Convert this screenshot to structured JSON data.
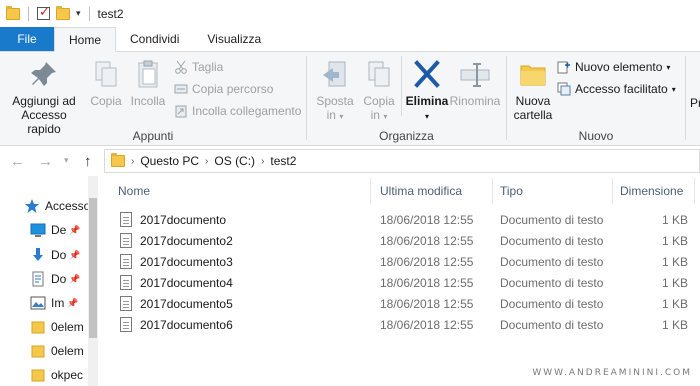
{
  "window": {
    "title": "test2"
  },
  "tabs": [
    {
      "label": "File"
    },
    {
      "label": "Home"
    },
    {
      "label": "Condividi"
    },
    {
      "label": "Visualizza"
    }
  ],
  "ribbon": {
    "appunti": {
      "label": "Appunti",
      "pin_label": "Aggiungi ad Accesso rapido",
      "pin_line1": "Aggiungi ad",
      "pin_line2": "Accesso rapido",
      "copy_label": "Copia",
      "paste_label": "Incolla",
      "cut_label": "Taglia",
      "copy_path_label": "Copia percorso",
      "paste_shortcut_label": "Incolla collegamento"
    },
    "organizza": {
      "label": "Organizza",
      "move_line1": "Sposta",
      "move_line2": "in",
      "copyto_line1": "Copia",
      "copyto_line2": "in",
      "delete_label": "Elimina",
      "rename_label": "Rinomina"
    },
    "nuovo": {
      "label": "Nuovo",
      "new_folder_line1": "Nuova",
      "new_folder_line2": "cartella",
      "new_item_label": "Nuovo elemento",
      "easy_access_label": "Accesso facilitato"
    },
    "next_group_partial": "Pr"
  },
  "address": {
    "segments": [
      "Questo PC",
      "OS (C:)",
      "test2"
    ]
  },
  "nav_pane": {
    "items": [
      {
        "label": "Accesso",
        "icon": "star-icon"
      },
      {
        "label": "De",
        "icon": "desktop-icon"
      },
      {
        "label": "Do",
        "icon": "download-icon"
      },
      {
        "label": "Do",
        "icon": "document-icon"
      },
      {
        "label": "Im",
        "icon": "image-icon"
      },
      {
        "label": "0elem",
        "icon": "folder-icon"
      },
      {
        "label": "0elem",
        "icon": "folder-icon"
      },
      {
        "label": "okpec",
        "icon": "folder-icon"
      }
    ]
  },
  "file_list": {
    "columns": [
      "Nome",
      "Ultima modifica",
      "Tipo",
      "Dimensione"
    ],
    "rows": [
      {
        "name": "2017documento",
        "modified": "18/06/2018 12:55",
        "type": "Documento di testo",
        "size": "1 KB"
      },
      {
        "name": "2017documento2",
        "modified": "18/06/2018 12:55",
        "type": "Documento di testo",
        "size": "1 KB"
      },
      {
        "name": "2017documento3",
        "modified": "18/06/2018 12:55",
        "type": "Documento di testo",
        "size": "1 KB"
      },
      {
        "name": "2017documento4",
        "modified": "18/06/2018 12:55",
        "type": "Documento di testo",
        "size": "1 KB"
      },
      {
        "name": "2017documento5",
        "modified": "18/06/2018 12:55",
        "type": "Documento di testo",
        "size": "1 KB"
      },
      {
        "name": "2017documento6",
        "modified": "18/06/2018 12:55",
        "type": "Documento di testo",
        "size": "1 KB"
      }
    ]
  },
  "watermark": "WWW.ANDREAMININI.COM",
  "colors": {
    "accent": "#1979ca",
    "folder": "#f5c84c",
    "delete": "#1e5aa8"
  }
}
